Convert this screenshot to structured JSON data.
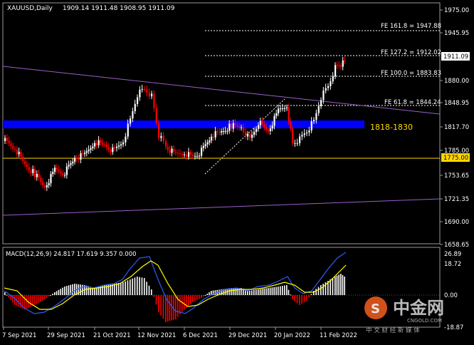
{
  "chart_data": {
    "type": "candlestick",
    "symbol_header": "XAUUSD,Daily",
    "ohlc_header": "1909.14 1911.48 1908.95 1911.09",
    "current_price_label": "1911.09",
    "price_ticks": [
      "1975.00",
      "1945.95",
      "1911.09",
      "1880.00",
      "1848.95",
      "1817.70",
      "1785.00",
      "1775.00",
      "1753.65",
      "1721.35",
      "1690.00",
      "1658.65"
    ],
    "date_ticks": [
      "7 Sep 2021",
      "29 Sep 2021",
      "21 Oct 2021",
      "12 Nov 2021",
      "6 Dec 2021",
      "29 Dec 2021",
      "20 Jan 2022",
      "11 Feb 2022"
    ],
    "fib_levels": [
      {
        "label": "FE 161.8 = 1947.88",
        "price": 1947.88
      },
      {
        "label": "FE 127.2 = 1912.02",
        "price": 1912.02
      },
      {
        "label": "FE 100.0 = 1883.83",
        "price": 1883.83
      },
      {
        "label": "FE 61.8 = 1844.24",
        "price": 1844.24
      }
    ],
    "support_zone": {
      "label": "1818-1830",
      "low": 1818,
      "high": 1830
    },
    "support_line": {
      "label": "1775.00",
      "price": 1775.0
    },
    "macd": {
      "header": "MACD(12,26,9) 24.817 17.619 9.357 0.000",
      "ticks": [
        "26.89",
        "18.72",
        "0.00",
        "-18.87"
      ]
    },
    "colors": {
      "up": "#ffffff",
      "down": "#ff0000",
      "zone": "#0000ff",
      "fib": "#ffffff",
      "trend": "#9b5fc9",
      "support": "#ffd700",
      "macd_line": "#2f5bff",
      "signal_line": "#ffff00"
    }
  },
  "watermark": {
    "cn": "中金网",
    "sub": "中 文 财 经 新 媒 体",
    "domain": "CNGOLD.COM"
  }
}
